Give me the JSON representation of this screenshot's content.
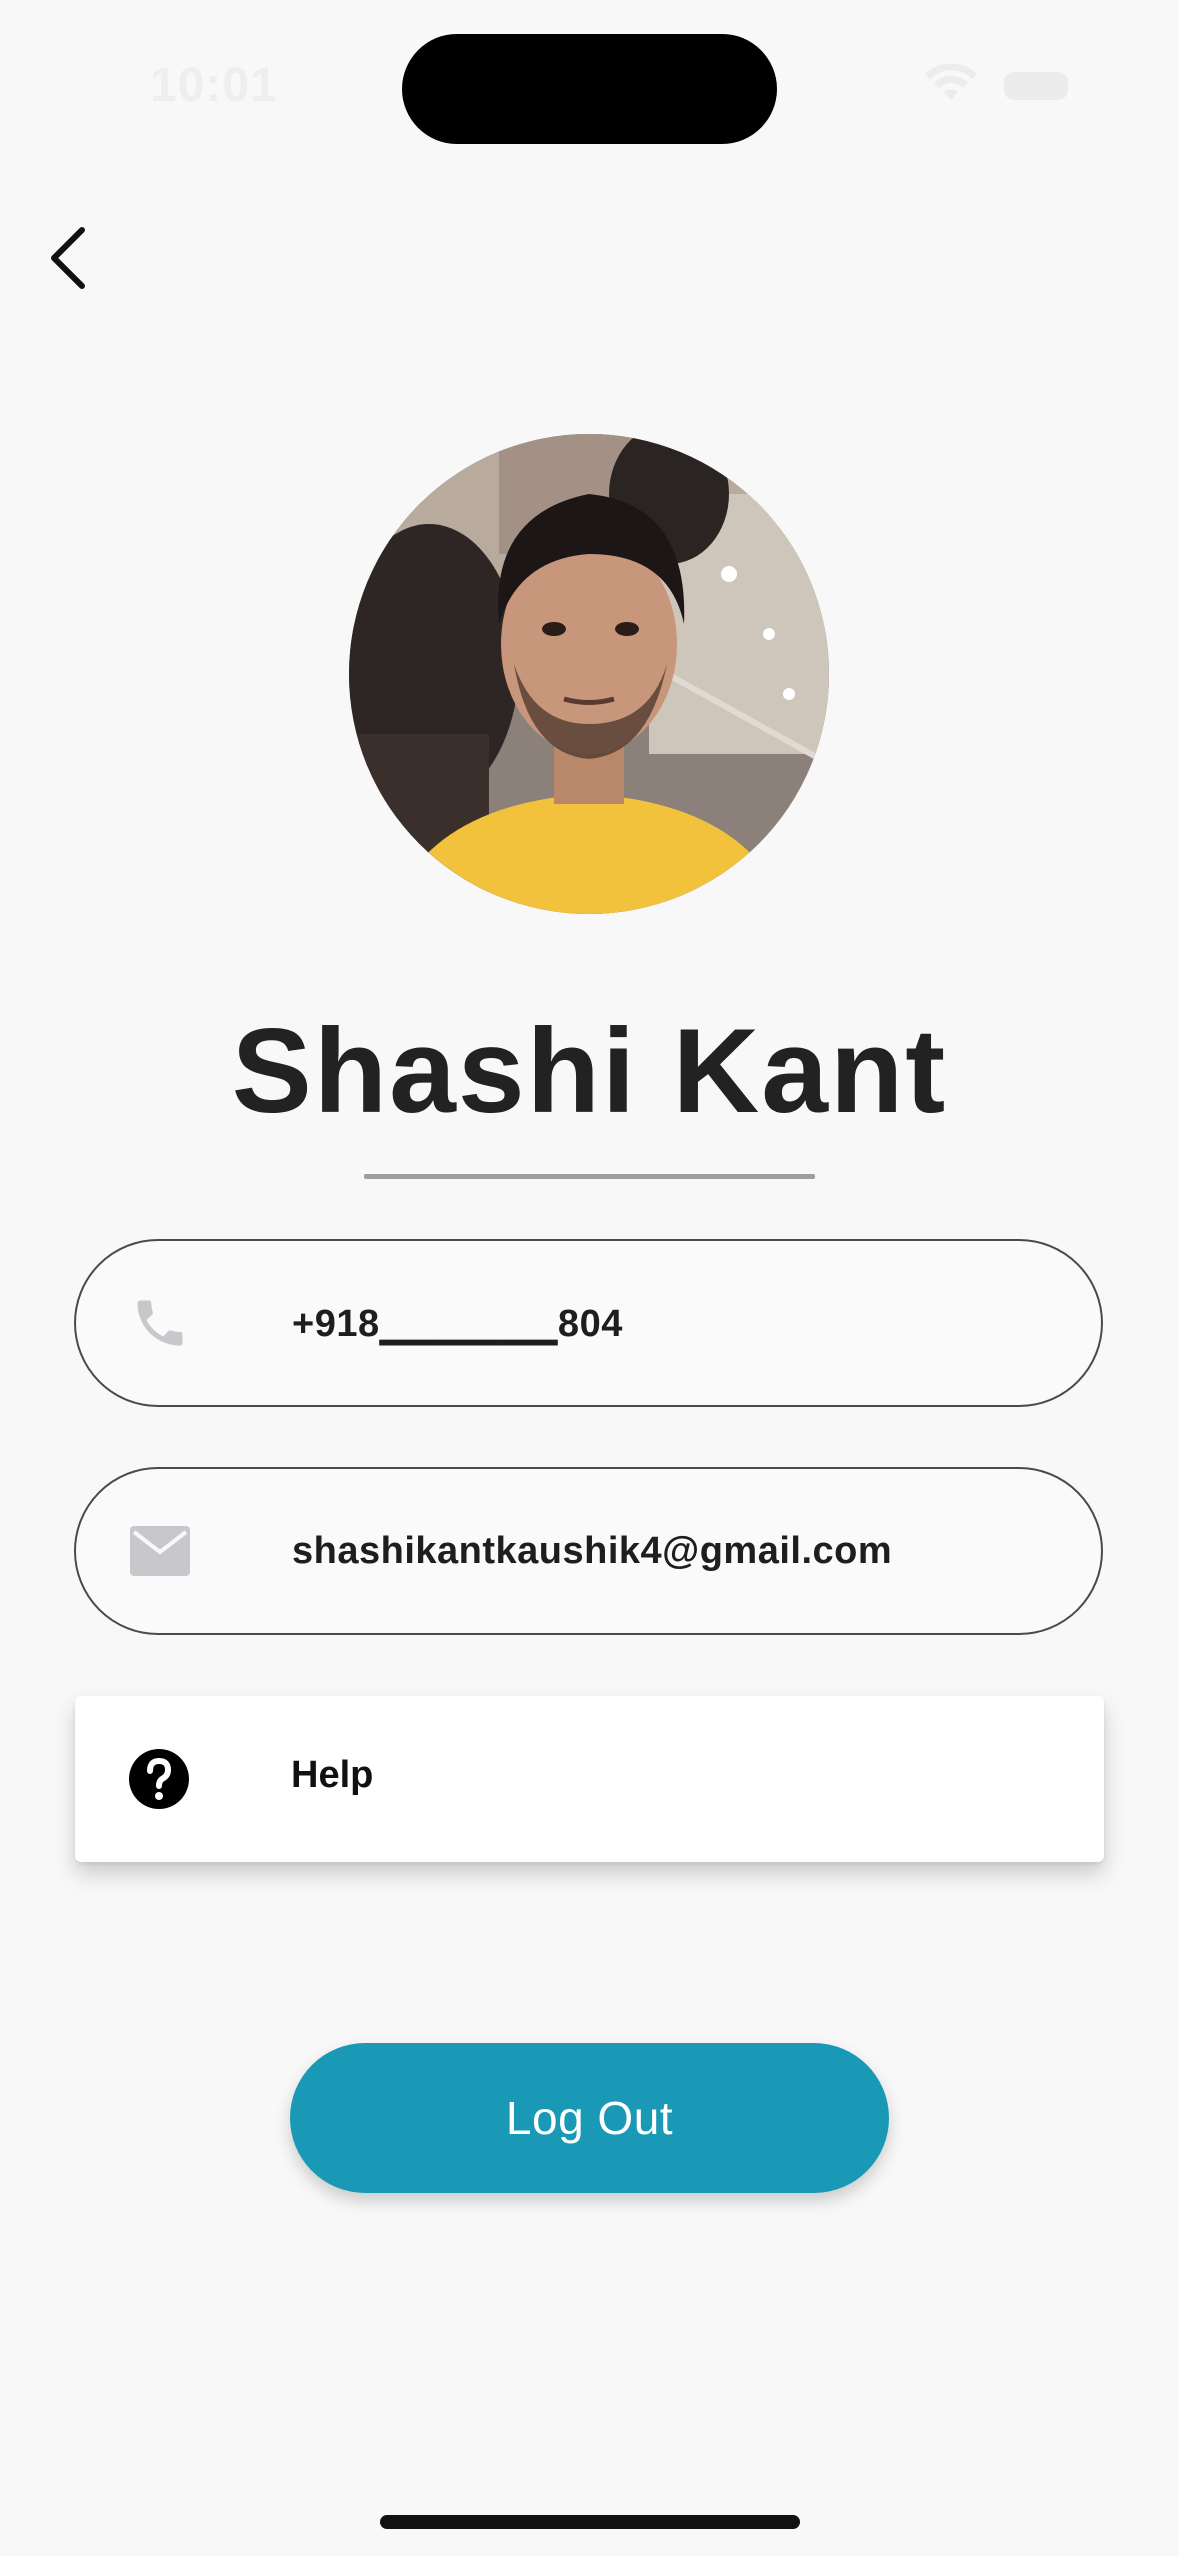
{
  "status_bar": {
    "time": "10:01",
    "icons": [
      "wifi-icon",
      "battery-icon"
    ]
  },
  "nav": {
    "back_icon": "chevron-left-icon"
  },
  "profile": {
    "name": "Shashi Kant",
    "avatar": "profile-photo"
  },
  "fields": {
    "phone": {
      "icon": "phone-icon",
      "value": "+918▁▁▁▁▁▁804"
    },
    "email": {
      "icon": "mail-icon",
      "value": "shashikantkaushik4@gmail.com"
    }
  },
  "help": {
    "icon": "help-circle-icon",
    "label": "Help"
  },
  "logout": {
    "label": "Log Out"
  },
  "colors": {
    "background": "#f8f8f8",
    "accent": "#1999b5",
    "text": "#222222",
    "icon_grey": "#c7c7cc"
  }
}
